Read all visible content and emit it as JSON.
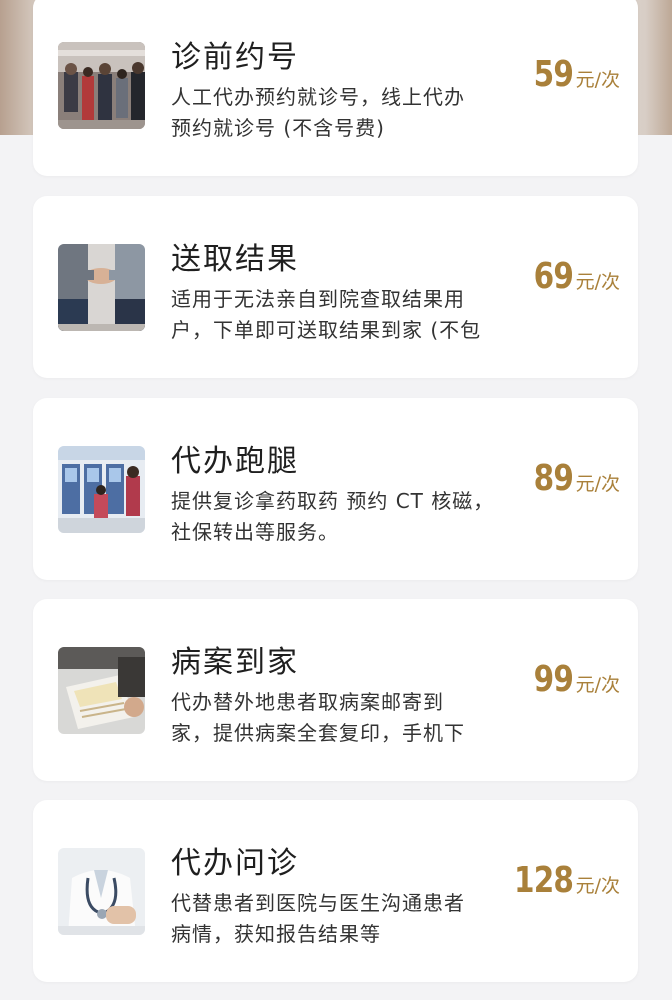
{
  "services": [
    {
      "title": "诊前约号",
      "desc_line1": "人工代办预约就诊号，线上代办",
      "desc_line2": "预约就诊号 (不含号费)",
      "price": "59",
      "unit": "元/次",
      "thumb_icon": "hospital-queue-photo"
    },
    {
      "title": "送取结果",
      "desc_line1": "适用于无法亲自到院查取结果用",
      "desc_line2": "户，下单即可送取结果到家 (不包",
      "price": "69",
      "unit": "元/次",
      "thumb_icon": "handshake-photo"
    },
    {
      "title": "代办跑腿",
      "desc_line1": "提供复诊拿药取药 预约 CT 核磁，",
      "desc_line2": "社保转出等服务。",
      "price": "89",
      "unit": "元/次",
      "thumb_icon": "self-service-kiosk-photo"
    },
    {
      "title": "病案到家",
      "desc_line1": "代办替外地患者取病案邮寄到",
      "desc_line2": "家，提供病案全套复印，手机下",
      "price": "99",
      "unit": "元/次",
      "thumb_icon": "documents-desk-photo"
    },
    {
      "title": "代办问诊",
      "desc_line1": "代替患者到医院与医生沟通患者",
      "desc_line2": "病情，获知报告结果等",
      "price": "128",
      "unit": "元/次",
      "thumb_icon": "doctor-stethoscope-photo"
    }
  ],
  "colors": {
    "price": "#a9803a",
    "background": "#f3f3f5",
    "card": "#ffffff"
  }
}
